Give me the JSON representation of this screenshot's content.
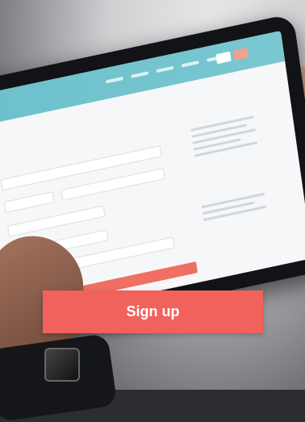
{
  "cta": {
    "label": "Sign up"
  },
  "colors": {
    "accent": "#f0625b",
    "nav": "#6cc0cc"
  },
  "icons": {
    "logo": "circle-logo-icon"
  }
}
